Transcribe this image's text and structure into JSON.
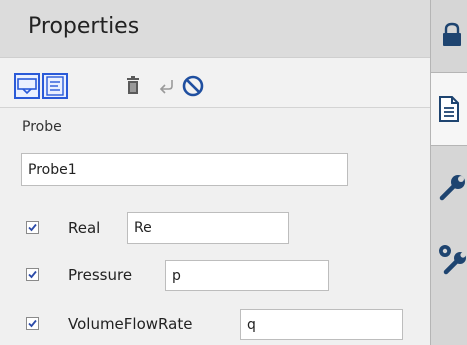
{
  "panel": {
    "title": "Properties"
  },
  "toolbar": {
    "buttons": [
      {
        "icon": "comment-view-icon",
        "active": true
      },
      {
        "icon": "document-view-icon",
        "active": true
      },
      {
        "icon": "trash-icon"
      },
      {
        "icon": "return-arrow-icon"
      },
      {
        "icon": "prohibited-icon"
      }
    ]
  },
  "probe": {
    "section_label": "Probe",
    "name_value": "Probe1"
  },
  "variables": [
    {
      "label": "Real",
      "value": "Re",
      "checked": true
    },
    {
      "label": "Pressure",
      "value": "p",
      "checked": true
    },
    {
      "label": "VolumeFlowRate",
      "value": "q",
      "checked": true
    }
  ],
  "side_tabs": [
    {
      "icon": "lock-icon"
    },
    {
      "icon": "document-icon",
      "active": true
    },
    {
      "icon": "wrench-icon"
    },
    {
      "icon": "settings-wrench-icon"
    }
  ],
  "colors": {
    "accent": "#2a5ad8",
    "header_bg": "#dcdcdc",
    "icon_dark": "#1f4f86"
  }
}
